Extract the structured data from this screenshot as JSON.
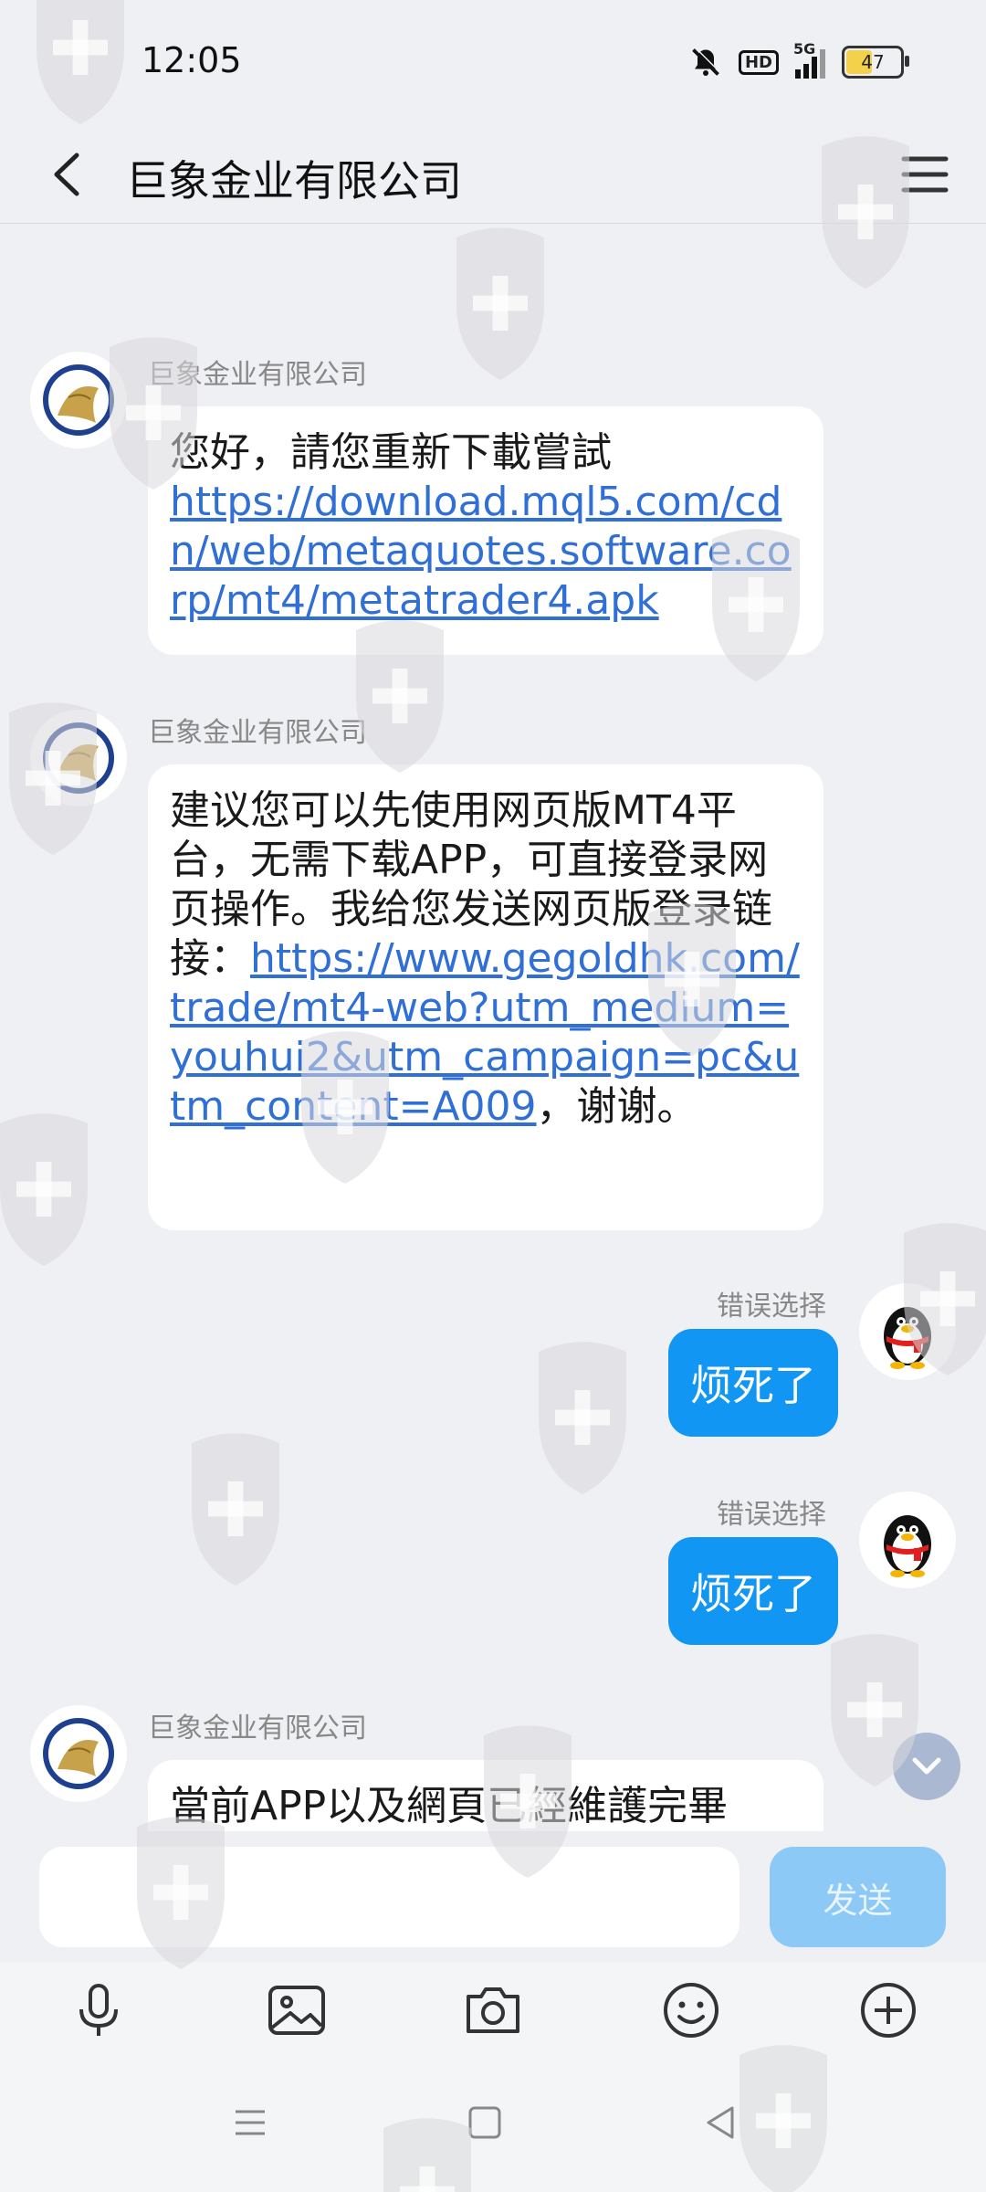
{
  "status_bar": {
    "time": "12:05",
    "battery": "47",
    "network": "5G",
    "hd": "HD"
  },
  "header": {
    "title": "巨象金业有限公司"
  },
  "messages": [
    {
      "sender": "巨象金业有限公司",
      "text": "您好，請您重新下載嘗試",
      "link": "https://download.mql5.com/cdn/web/metaquotes.software.corp/mt4/metatrader4.apk"
    },
    {
      "sender": "巨象金业有限公司",
      "text": "建议您可以先使用网页版MT4平台，无需下载APP，可直接登录网页操作。我给您发送网页版登录链接：",
      "link": "https://www.gegoldhk.com/trade/mt4-web?utm_medium=youhui2&utm_campaign=pc&utm_content=A009",
      "suffix": "，谢谢。"
    },
    {
      "sender": "错误选择",
      "text": "烦死了"
    },
    {
      "sender": "错误选择",
      "text": "烦死了"
    },
    {
      "sender": "巨象金业有限公司",
      "text": "當前APP以及網頁已經維護完畢"
    }
  ],
  "input": {
    "send_label": "发送",
    "value": ""
  },
  "toolbar": {
    "icons": [
      "microphone-icon",
      "image-icon",
      "camera-icon",
      "emoji-icon",
      "plus-icon"
    ]
  },
  "colors": {
    "accent": "#1296f3",
    "link": "#2f6fd6",
    "background": "#eff0f3",
    "send_disabled": "#8cc9f7"
  }
}
